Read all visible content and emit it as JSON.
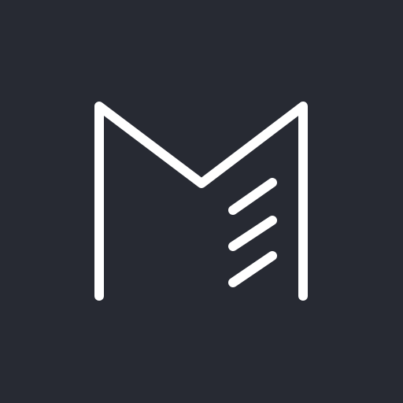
{
  "app_icon": {
    "icon": "m-logo-icon",
    "colors": {
      "background": "#272a33",
      "stroke": "#ffffff"
    }
  }
}
